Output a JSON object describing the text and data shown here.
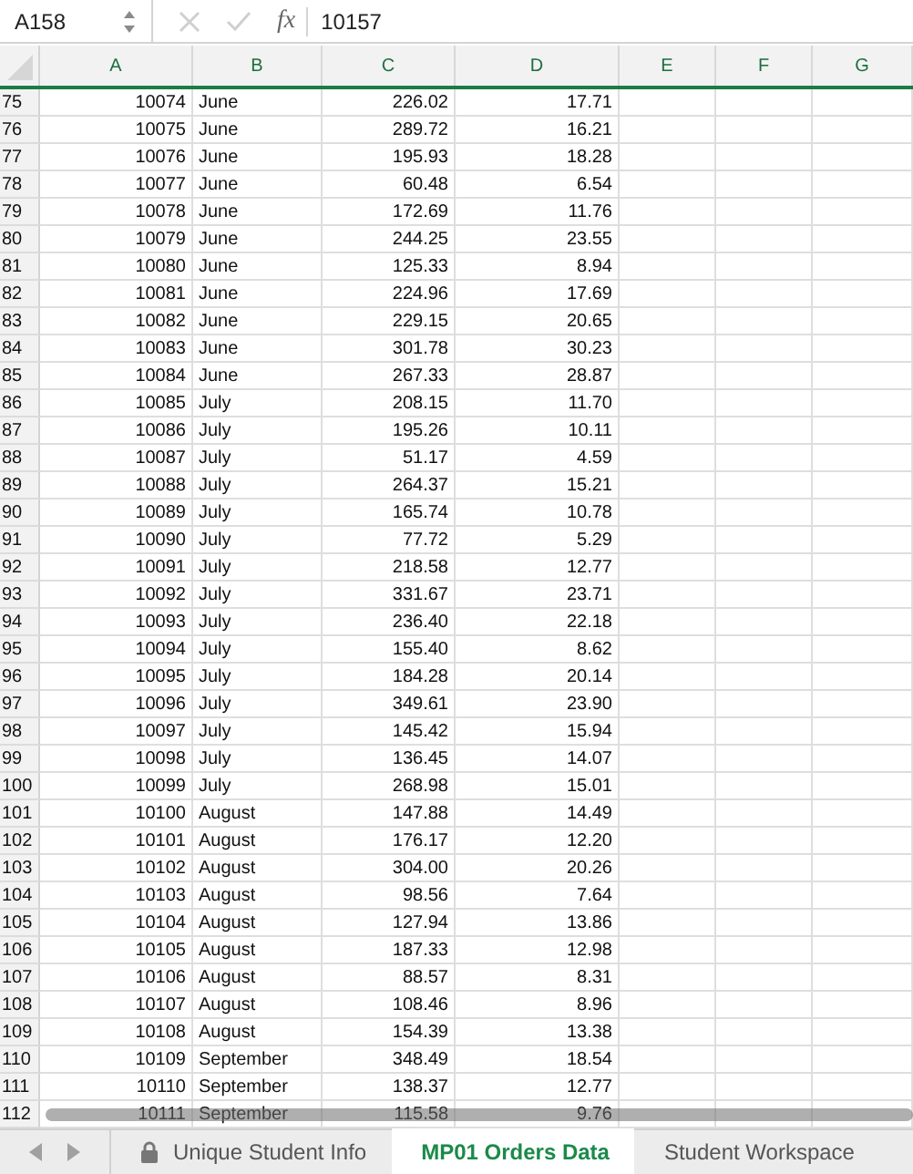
{
  "formula_bar": {
    "name_box": "A158",
    "cancel_disabled": true,
    "confirm_disabled": true,
    "fx": "fx",
    "formula": "10157"
  },
  "columns": [
    "A",
    "B",
    "C",
    "D",
    "E",
    "F",
    "G"
  ],
  "rows": [
    [
      "75",
      "10074",
      "June",
      "226.02",
      "17.71"
    ],
    [
      "76",
      "10075",
      "June",
      "289.72",
      "16.21"
    ],
    [
      "77",
      "10076",
      "June",
      "195.93",
      "18.28"
    ],
    [
      "78",
      "10077",
      "June",
      "60.48",
      "6.54"
    ],
    [
      "79",
      "10078",
      "June",
      "172.69",
      "11.76"
    ],
    [
      "80",
      "10079",
      "June",
      "244.25",
      "23.55"
    ],
    [
      "81",
      "10080",
      "June",
      "125.33",
      "8.94"
    ],
    [
      "82",
      "10081",
      "June",
      "224.96",
      "17.69"
    ],
    [
      "83",
      "10082",
      "June",
      "229.15",
      "20.65"
    ],
    [
      "84",
      "10083",
      "June",
      "301.78",
      "30.23"
    ],
    [
      "85",
      "10084",
      "June",
      "267.33",
      "28.87"
    ],
    [
      "86",
      "10085",
      "July",
      "208.15",
      "11.70"
    ],
    [
      "87",
      "10086",
      "July",
      "195.26",
      "10.11"
    ],
    [
      "88",
      "10087",
      "July",
      "51.17",
      "4.59"
    ],
    [
      "89",
      "10088",
      "July",
      "264.37",
      "15.21"
    ],
    [
      "90",
      "10089",
      "July",
      "165.74",
      "10.78"
    ],
    [
      "91",
      "10090",
      "July",
      "77.72",
      "5.29"
    ],
    [
      "92",
      "10091",
      "July",
      "218.58",
      "12.77"
    ],
    [
      "93",
      "10092",
      "July",
      "331.67",
      "23.71"
    ],
    [
      "94",
      "10093",
      "July",
      "236.40",
      "22.18"
    ],
    [
      "95",
      "10094",
      "July",
      "155.40",
      "8.62"
    ],
    [
      "96",
      "10095",
      "July",
      "184.28",
      "20.14"
    ],
    [
      "97",
      "10096",
      "July",
      "349.61",
      "23.90"
    ],
    [
      "98",
      "10097",
      "July",
      "145.42",
      "15.94"
    ],
    [
      "99",
      "10098",
      "July",
      "136.45",
      "14.07"
    ],
    [
      "100",
      "10099",
      "July",
      "268.98",
      "15.01"
    ],
    [
      "101",
      "10100",
      "August",
      "147.88",
      "14.49"
    ],
    [
      "102",
      "10101",
      "August",
      "176.17",
      "12.20"
    ],
    [
      "103",
      "10102",
      "August",
      "304.00",
      "20.26"
    ],
    [
      "104",
      "10103",
      "August",
      "98.56",
      "7.64"
    ],
    [
      "105",
      "10104",
      "August",
      "127.94",
      "13.86"
    ],
    [
      "106",
      "10105",
      "August",
      "187.33",
      "12.98"
    ],
    [
      "107",
      "10106",
      "August",
      "88.57",
      "8.31"
    ],
    [
      "108",
      "10107",
      "August",
      "108.46",
      "8.96"
    ],
    [
      "109",
      "10108",
      "August",
      "154.39",
      "13.38"
    ],
    [
      "110",
      "10109",
      "September",
      "348.49",
      "18.54"
    ],
    [
      "111",
      "10110",
      "September",
      "138.37",
      "12.77"
    ],
    [
      "112",
      "10111",
      "September",
      "115.58",
      "9.76"
    ]
  ],
  "sheet_tabs": [
    {
      "label": "Unique Student Info",
      "locked": true,
      "selected": false
    },
    {
      "label": "MP01 Orders Data",
      "locked": false,
      "selected": true
    },
    {
      "label": "Student Workspace",
      "locked": false,
      "selected": false
    }
  ]
}
